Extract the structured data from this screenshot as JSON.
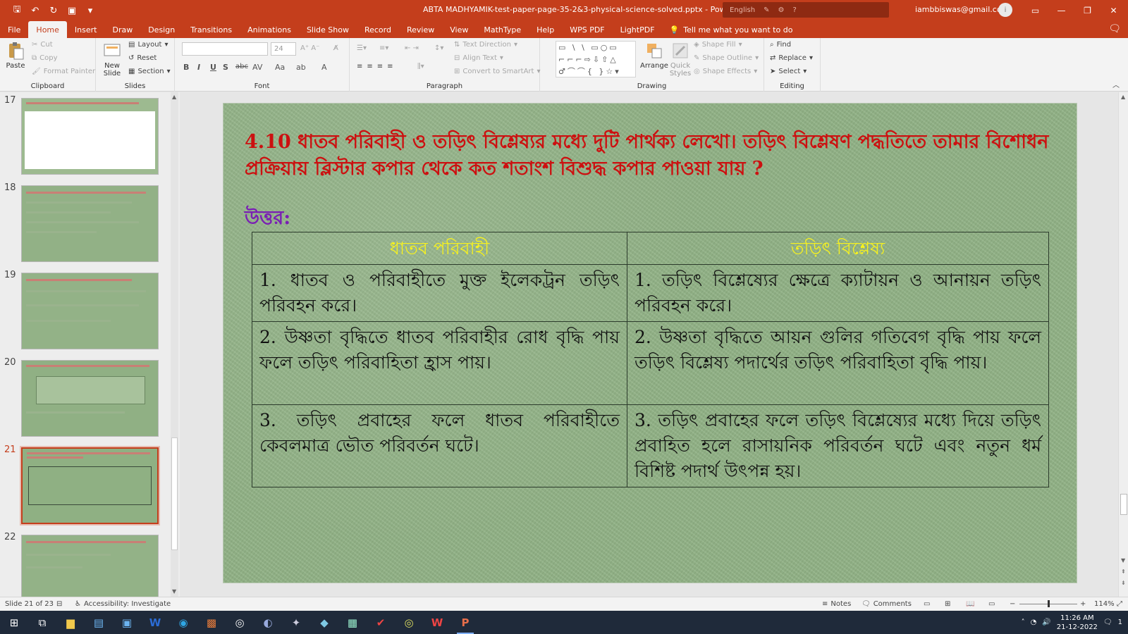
{
  "window": {
    "title": "ABTA MADHYAMIK-test-paper-page-35-2&3-physical-science-solved.pptx - PowerPoint",
    "account": "iambbiswas@gmail.com",
    "avatar_initial": "i",
    "language": "English"
  },
  "menu": {
    "tabs": [
      "File",
      "Home",
      "Insert",
      "Draw",
      "Design",
      "Transitions",
      "Animations",
      "Slide Show",
      "Record",
      "Review",
      "View",
      "MathType",
      "Help",
      "WPS PDF",
      "LightPDF"
    ],
    "active": "Home",
    "tell_me": "Tell me what you want to do"
  },
  "ribbon": {
    "clipboard": {
      "label": "Clipboard",
      "paste": "Paste",
      "cut": "Cut",
      "copy": "Copy",
      "format_painter": "Format Painter"
    },
    "slides": {
      "label": "Slides",
      "new_slide": "New Slide",
      "layout": "Layout",
      "reset": "Reset",
      "section": "Section"
    },
    "font": {
      "label": "Font",
      "size": "24"
    },
    "paragraph": {
      "label": "Paragraph",
      "text_direction": "Text Direction",
      "align_text": "Align Text",
      "convert_smartart": "Convert to SmartArt"
    },
    "drawing": {
      "label": "Drawing",
      "arrange": "Arrange",
      "quick_styles": "Quick Styles",
      "shape_fill": "Shape Fill",
      "shape_outline": "Shape Outline",
      "shape_effects": "Shape Effects"
    },
    "editing": {
      "label": "Editing",
      "find": "Find",
      "replace": "Replace",
      "select": "Select"
    }
  },
  "thumbnails": [
    {
      "number": "17"
    },
    {
      "number": "18"
    },
    {
      "number": "19"
    },
    {
      "number": "20"
    },
    {
      "number": "21"
    },
    {
      "number": "22"
    }
  ],
  "slide": {
    "question": "4.10 ধাতব পরিবাহী ও তড়িৎ বিশ্লেষ্যর মধ্যে দুটি পার্থক্য লেখো। তড়িৎ বিশ্লেষণ পদ্ধতিতে তামার বিশোধন প্রক্রিয়ায় ব্লিস্টার কপার থেকে কত শতাংশ বিশুদ্ধ কপার পাওয়া যায় ?",
    "answer_label": "উত্তর:",
    "table": {
      "headers": [
        "ধাতব পরিবাহী",
        "তড়িৎ বিশ্লেষ্য"
      ],
      "rows": [
        [
          "1. ধাতব ও পরিবাহীতে মুক্ত ইলেকট্রন তড়িৎ পরিবহন করে।",
          "1. তড়িৎ বিশ্লেষ্যের ক্ষেত্রে ক্যাটায়ন ও আনায়ন তড়িৎ পরিবহন করে।"
        ],
        [
          "2. উষ্ণতা বৃদ্ধিতে ধাতব পরিবাহীর রোধ বৃদ্ধি পায় ফলে তড়িৎ পরিবাহিতা হ্রাস পায়।",
          "2. উষ্ণতা বৃদ্ধিতে আয়ন গুলির গতিবেগ বৃদ্ধি পায় ফলে তড়িৎ বিশ্লেষ্য পদার্থের তড়িৎ পরিবাহিতা বৃদ্ধি পায়।"
        ],
        [
          "3. তড়িৎ প্রবাহের ফলে ধাতব পরিবাহীতে কেবলমাত্র ভৌত পরিবর্তন ঘটে।",
          "3. তড়িৎ প্রবাহের ফলে তড়িৎ বিশ্লেষ্যের মধ্যে দিয়ে তড়িৎ প্রবাহিত হলে রাসায়নিক পরিবর্তন ঘটে এবং নতুন ধর্ম বিশিষ্ট পদার্থ উৎপন্ন হয়।"
        ]
      ]
    }
  },
  "status": {
    "slide_info": "Slide 21 of 23",
    "accessibility": "Accessibility: Investigate",
    "notes": "Notes",
    "comments": "Comments",
    "zoom": "114%"
  },
  "taskbar": {
    "time": "11:26 AM",
    "date": "21-12-2022",
    "notification_count": "1"
  },
  "colors": {
    "accent": "#c43e1c",
    "question": "#cc1010",
    "answer": "#7a1fb4",
    "header": "#f7f21e",
    "slide_bg": "#8fb083"
  }
}
